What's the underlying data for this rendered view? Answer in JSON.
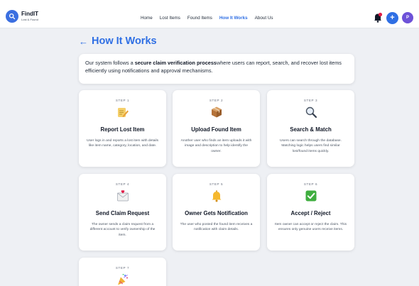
{
  "brand": {
    "name": "FindIT",
    "tagline": "Lost & Found"
  },
  "nav": {
    "links": [
      "Home",
      "Lost Items",
      "Found Items",
      "How It Works",
      "About Us"
    ],
    "active": "How It Works",
    "avatar_initial": "P"
  },
  "icons": {
    "logo": "search-icon",
    "notification": "bell-icon",
    "add": "plus-icon",
    "back": "arrow-left-icon"
  },
  "colors": {
    "accent": "#2f6fe4",
    "avatar": "#6d52d8",
    "notification_dot": "#e11d48"
  },
  "page": {
    "back_symbol": "←",
    "title": "How It Works",
    "intro": {
      "before": "Our system follows a ",
      "bold": "secure claim verification process",
      "after": "where users can report, search, and recover lost items efficiently using notifications and approval mechanisms."
    }
  },
  "steps": [
    {
      "label": "STEP 1",
      "title": "Report Lost Item",
      "icon": "memo-pencil-icon",
      "desc": "User logs in and reports a lost item with details like item name, category, location, and date."
    },
    {
      "label": "STEP 2",
      "title": "Upload Found Item",
      "icon": "package-box-icon",
      "desc": "Another user who finds an item uploads it with image and description to help identify the owner."
    },
    {
      "label": "STEP 3",
      "title": "Search & Match",
      "icon": "magnifier-icon",
      "desc": "Users can search through the database. Matching logic helps users find similar lost/found items quickly."
    },
    {
      "label": "STEP 4",
      "title": "Send Claim Request",
      "icon": "envelope-icon",
      "desc": "The owner sends a claim request from a different account to verify ownership of the item."
    },
    {
      "label": "STEP 5",
      "title": "Owner Gets Notification",
      "icon": "bell-icon",
      "desc": "The user who posted the found item receives a notification with claim details."
    },
    {
      "label": "STEP 6",
      "title": "Accept / Reject",
      "icon": "check-box-icon",
      "desc": "Item owner can accept or reject the claim. This ensures only genuine users receive items."
    },
    {
      "label": "STEP 7",
      "title": "",
      "icon": "party-popper-icon",
      "desc": ""
    }
  ]
}
